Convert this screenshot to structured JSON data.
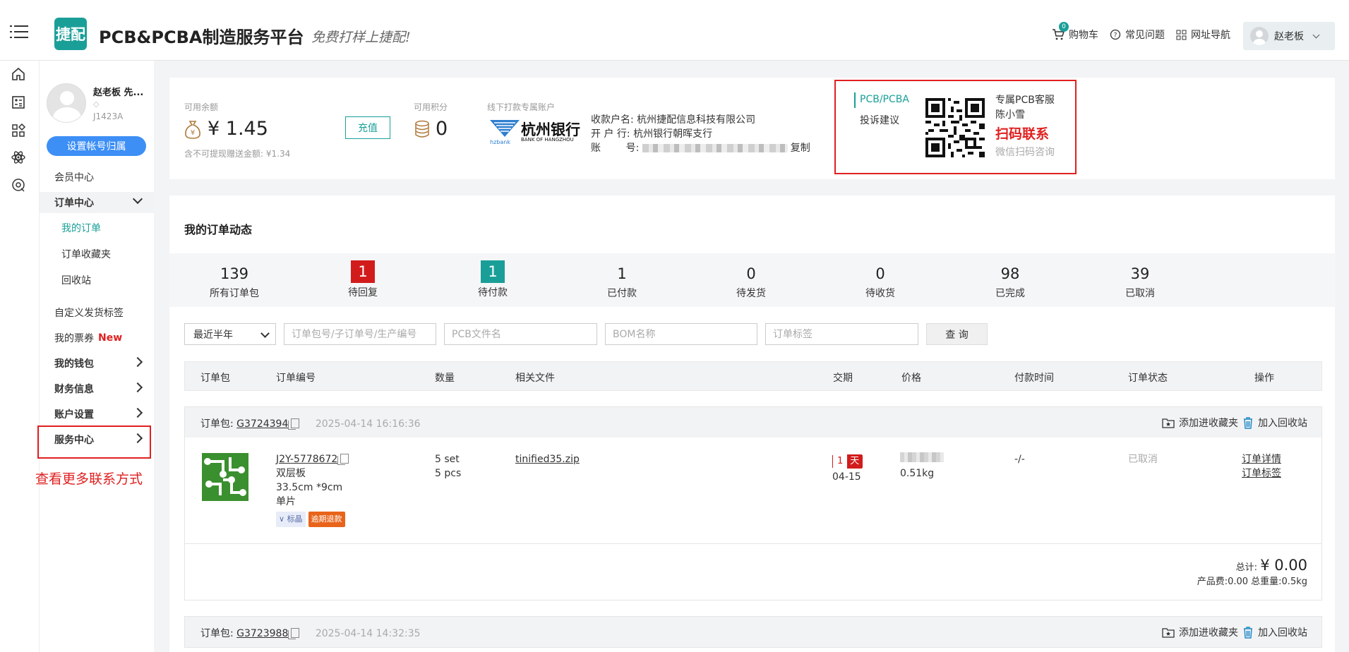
{
  "header": {
    "logo_text": "捷配",
    "title": "PCB&PCBA制造服务平台",
    "slogan": "免费打样上捷配!",
    "cart_count": "0",
    "cart_label": "购物车",
    "faq_label": "常见问题",
    "sitemap_label": "网址导航",
    "user_name": "赵老板"
  },
  "sidebar": {
    "user_name": "赵老板 先...",
    "user_id": "J1423A",
    "setup_button": "设置帐号归属",
    "member_center": "会员中心",
    "order_center": "订单中心",
    "my_orders": "我的订单",
    "order_favorites": "订单收藏夹",
    "recycle_bin": "回收站",
    "custom_labels": "自定义发货标签",
    "my_tickets": "我的票券",
    "new_badge": "New",
    "my_wallet": "我的钱包",
    "finance_info": "财务信息",
    "account_settings": "账户设置",
    "service_center": "服务中心",
    "contact_note": "查看更多联系方式"
  },
  "account": {
    "balance_label": "可用余额",
    "balance_value": "¥ 1.45",
    "balance_note": "含不可提现赠送金额: ¥1.34",
    "recharge_button": "充值",
    "points_label": "可用积分",
    "points_value": "0",
    "offline_label": "线下打款专属账户",
    "bank_name": "杭州银行",
    "bank_name_en": "BANK OF HANGZHOU",
    "bank_small": "hzbank",
    "payee_line": "收款户名: 杭州捷配信息科技有限公司",
    "bank_line": "开  户  行: 杭州银行朝晖支行",
    "account_prefix": "账        号: ",
    "copy_label": "复制"
  },
  "service": {
    "tab_pcb": "PCB/PCBA",
    "tab_complaint": "投诉建议",
    "line1": "专属PCB客服",
    "line2": "陈小雪",
    "scan_title": "扫码联系",
    "scan_note": "微信扫码咨询"
  },
  "orders": {
    "title": "我的订单动态",
    "stats": [
      {
        "value": "139",
        "label": "所有订单包"
      },
      {
        "value": "1",
        "label": "待回复"
      },
      {
        "value": "1",
        "label": "待付款"
      },
      {
        "value": "1",
        "label": "已付款"
      },
      {
        "value": "0",
        "label": "待发货"
      },
      {
        "value": "0",
        "label": "待收货"
      },
      {
        "value": "98",
        "label": "已完成"
      },
      {
        "value": "39",
        "label": "已取消"
      }
    ],
    "filter": {
      "range": "最近半年",
      "order_no_placeholder": "订单包号/子订单号/生产编号",
      "pcb_placeholder": "PCB文件名",
      "bom_placeholder": "BOM名称",
      "tag_placeholder": "订单标签",
      "query_button": "查 询"
    },
    "columns": [
      "订单包",
      "订单编号",
      "数量",
      "相关文件",
      "交期",
      "价格",
      "付款时间",
      "订单状态",
      "操作"
    ],
    "packages": [
      {
        "label": "订单包:",
        "id": "G3724394",
        "date": "2025-04-14 16:16:36",
        "fav_action": "添加进收藏夹",
        "recycle_action": "加入回收站",
        "item": {
          "order_no": "J2Y-5778672",
          "board_type": "双层板",
          "size": "33.5cm *9cm",
          "panel": "单片",
          "tag1": "标晶",
          "tag2": "逾期退款",
          "qty1": "5 set",
          "qty2": "5 pcs",
          "file": "tinified35.zip",
          "due_num": "1",
          "due_unit": "天",
          "due_date": "04-15",
          "weight": "0.51kg",
          "pay_time": "-/-",
          "status": "已取消",
          "action_detail": "订单详情",
          "action_tag": "订单标签"
        },
        "total_label": "总计:",
        "total_value": "¥ 0.00",
        "total_detail": "产品费:0.00 总重量:0.5kg"
      },
      {
        "label": "订单包:",
        "id": "G3723988",
        "date": "2025-04-14 14:32:35",
        "fav_action": "添加进收藏夹",
        "recycle_action": "加入回收站"
      }
    ]
  },
  "colors": {
    "brand": "#1a9f98",
    "primary_button": "#3d8ff6",
    "alert_red": "#e02020",
    "pending_reply": "#d21c1c",
    "pending_payment": "#1a9f98"
  }
}
